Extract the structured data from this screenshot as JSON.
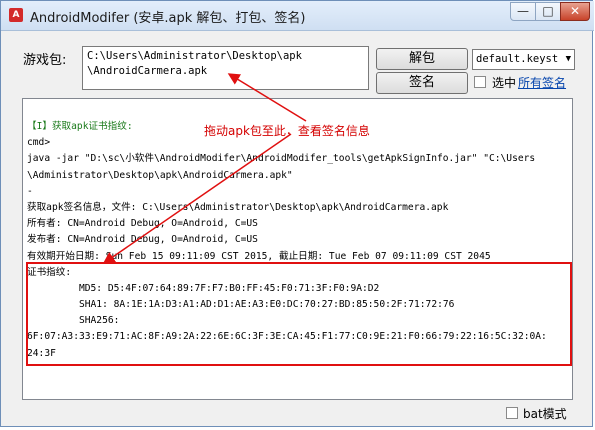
{
  "window": {
    "title": "AndroidModifer (安卓.apk 解包、打包、签名)",
    "icon": "android-app-icon",
    "min": "—",
    "max": "□",
    "close": "✕"
  },
  "package": {
    "label": "游戏包:",
    "path_line1": "C:\\Users\\Administrator\\Desktop\\apk",
    "path_line2": "\\AndroidCarmera.apk"
  },
  "buttons": {
    "unpack": "解包",
    "sign": "签名"
  },
  "keystore": {
    "selected": "default.keyst",
    "arrow": "▼"
  },
  "select_all_label": "选中",
  "all_signatures_link": "所有签名",
  "hint": "拖动apk包至此，查看签名信息",
  "log_lines": [
    "【I】获取apk证书指纹:",
    "cmd>",
    "java -jar \"D:\\sc\\小软件\\AndroidModifer\\AndroidModifer_tools\\getApkSignInfo.jar\" \"C:\\Users",
    "\\Administrator\\Desktop\\apk\\AndroidCarmera.apk\"",
    "-",
    "获取apk签名信息，文件: C:\\Users\\Administrator\\Desktop\\apk\\AndroidCarmera.apk",
    "所有者: CN=Android Debug, O=Android, C=US",
    "发布者: CN=Android Debug, O=Android, C=US",
    "有效期开始日期: Sun Feb 15 09:11:09 CST 2015, 截止日期: Tue Feb 07 09:11:09 CST 2045",
    "证书指纹:",
    "         MD5: D5:4F:07:64:89:7F:F7:B0:FF:45:F0:71:3F:F0:9A:D2",
    "         SHA1: 8A:1E:1A:D3:A1:AD:D1:AE:A3:E0:DC:70:27:BD:85:50:2F:71:72:76",
    "         SHA256:",
    "6F:07:A3:33:E9:71:AC:8F:A9:2A:22:6E:6C:3F:3E:CA:45:F1:77:C0:9E:21:F0:66:79:22:16:5C:32:0A:",
    "24:3F"
  ],
  "bat_mode_label": "bat模式"
}
